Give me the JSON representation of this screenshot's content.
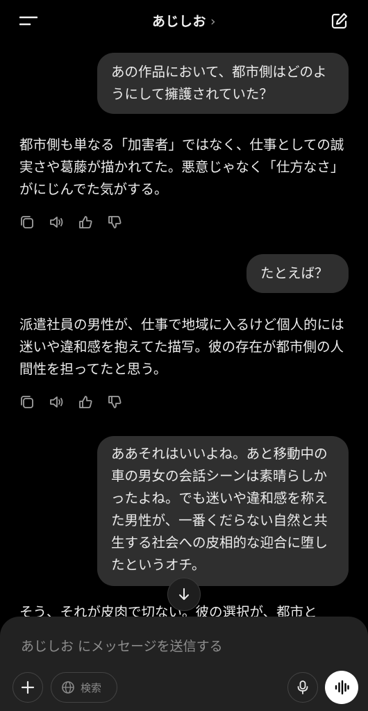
{
  "header": {
    "title": "あじしお",
    "chevron": "›"
  },
  "messages": [
    {
      "role": "user",
      "text": "あの作品において、都市側はどのようにして擁護されていた？"
    },
    {
      "role": "assistant",
      "text": "都市側も単なる「加害者」ではなく、仕事としての誠実さや葛藤が描かれてた。悪意じゃなく「仕方なさ」がにじんでた気がする。"
    },
    {
      "role": "user",
      "text": "たとえば？"
    },
    {
      "role": "assistant",
      "text": "派遣社員の男性が、仕事で地域に入るけど個人的には迷いや違和感を抱えてた描写。彼の存在が都市側の人間性を担ってたと思う。"
    },
    {
      "role": "user",
      "text": "ああそれはいいよね。あと移動中の車の男女の会話シーンは素晴らしかったよね。でも迷いや違和感を称えた男性が、一番くだらない自然と共生する社会への皮相的な迎合に堕したというオチ。"
    },
    {
      "role": "assistant",
      "text": "そう、それが皮肉で切ない。彼の選択が、都市と"
    }
  ],
  "composer": {
    "placeholder": "あじしお にメッセージを送信する",
    "search_label": "検索"
  },
  "colors": {
    "background": "#000000",
    "bubble": "#2f2f2f",
    "composer": "#222222"
  }
}
